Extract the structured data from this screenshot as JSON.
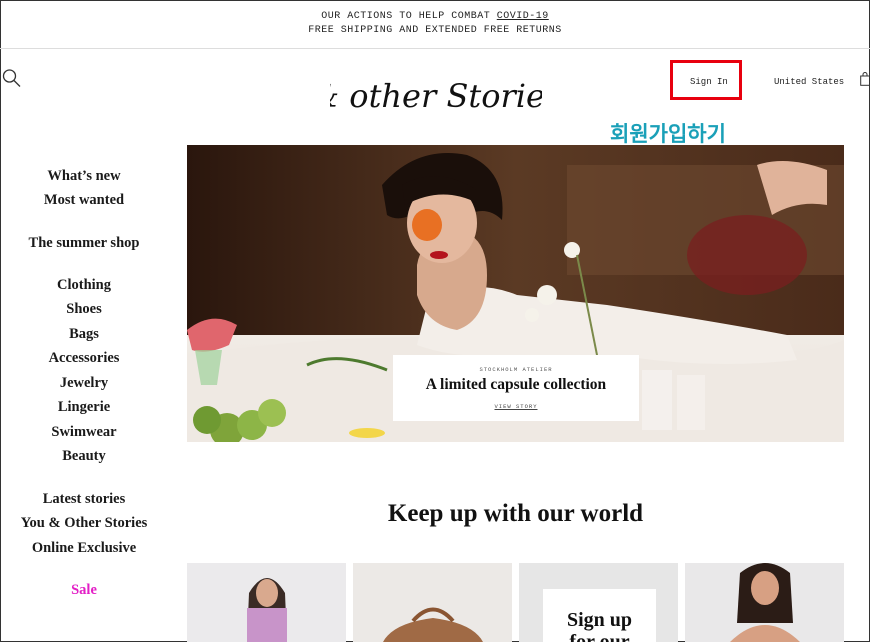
{
  "announcement": {
    "line1_prefix": "OUR ACTIONS TO HELP COMBAT ",
    "line1_link": "COVID-19",
    "line2": "FREE SHIPPING AND EXTENDED FREE RETURNS"
  },
  "header": {
    "logo_text": "& other Stories",
    "sign_in": "Sign In",
    "country": "United States"
  },
  "annotation": "회원가입하기",
  "sidebar": {
    "items": [
      {
        "label": "What’s new"
      },
      {
        "label": "Most wanted"
      },
      {
        "label": "The summer shop"
      },
      {
        "label": "Clothing"
      },
      {
        "label": "Shoes"
      },
      {
        "label": "Bags"
      },
      {
        "label": "Accessories"
      },
      {
        "label": "Jewelry"
      },
      {
        "label": "Lingerie"
      },
      {
        "label": "Swimwear"
      },
      {
        "label": "Beauty"
      },
      {
        "label": "Latest stories"
      },
      {
        "label": "You & Other Stories"
      },
      {
        "label": "Online Exclusive"
      },
      {
        "label": "Sale"
      }
    ]
  },
  "hero": {
    "eyebrow": "STOCKHOLM ATELIER",
    "title": "A limited capsule collection",
    "cta": "VIEW STORY"
  },
  "section": {
    "title": "Keep up with our world"
  },
  "signup": {
    "line1": "Sign up",
    "line2": "for our"
  },
  "colors": {
    "annotation": "#1aa0b8",
    "highlight_box": "#e8000e",
    "sale": "#e31ec6"
  }
}
